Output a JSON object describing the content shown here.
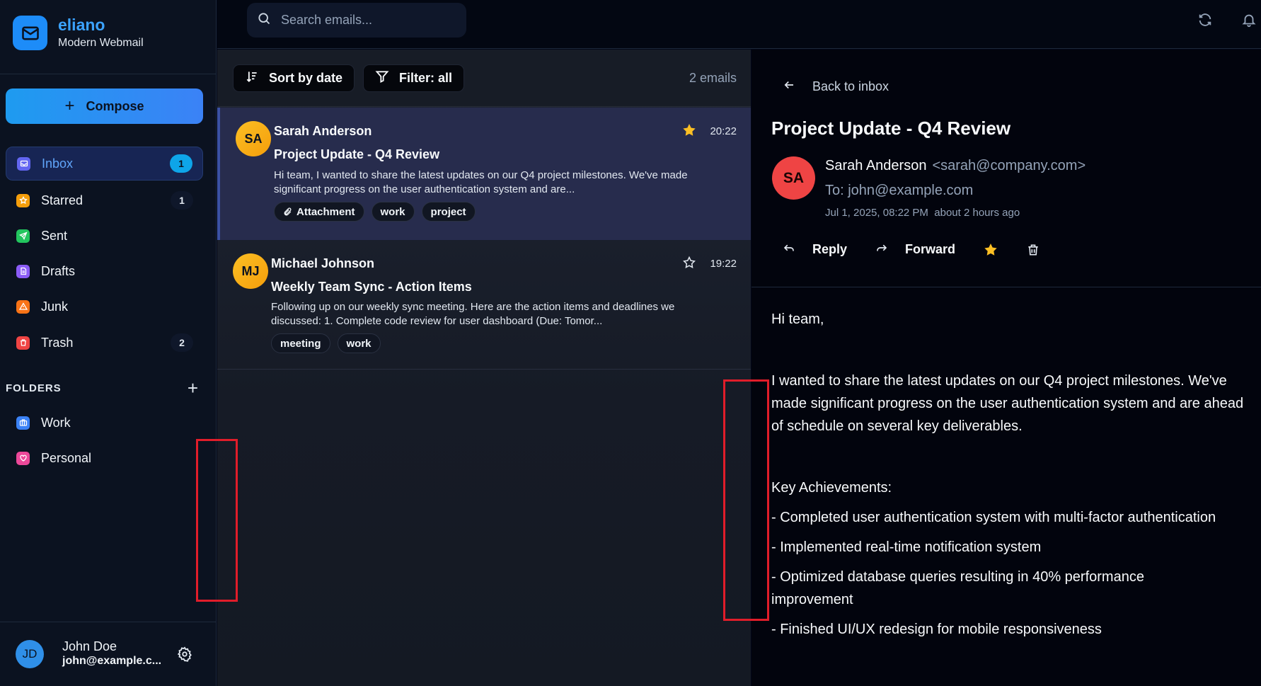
{
  "brand": {
    "name": "eliano",
    "subtitle": "Modern Webmail",
    "icon": "mail-icon"
  },
  "compose": {
    "label": "Compose",
    "icon": "plus-icon"
  },
  "nav": [
    {
      "label": "Inbox",
      "count": "1",
      "icon": "inbox-icon",
      "color": "#6366f1",
      "active": true
    },
    {
      "label": "Starred",
      "count": "1",
      "icon": "star-icon",
      "color": "#f59e0b"
    },
    {
      "label": "Sent",
      "count": "",
      "icon": "send-icon",
      "color": "#22c55e"
    },
    {
      "label": "Drafts",
      "count": "",
      "icon": "draft-icon",
      "color": "#8b5cf6"
    },
    {
      "label": "Junk",
      "count": "",
      "icon": "warning-icon",
      "color": "#f97316"
    },
    {
      "label": "Trash",
      "count": "2",
      "icon": "trash-icon",
      "color": "#ef4444"
    }
  ],
  "folders": {
    "title": "FOLDERS",
    "items": [
      {
        "label": "Work",
        "icon": "briefcase-icon",
        "color": "#3b82f6"
      },
      {
        "label": "Personal",
        "icon": "heart-icon",
        "color": "#ec4899"
      }
    ]
  },
  "user": {
    "initials": "JD",
    "name": "John Doe",
    "email": "john@example.c..."
  },
  "search": {
    "placeholder": "Search emails..."
  },
  "toolbar": {
    "sort_label": "Sort by date",
    "filter_label": "Filter: all",
    "count": "2 emails"
  },
  "emails": [
    {
      "initials": "SA",
      "from": "Sarah Anderson",
      "subject": "Project Update - Q4 Review",
      "preview": "Hi team, I wanted to share the latest updates on our Q4 project milestones. We've made significant progress on the user authentication system and are...",
      "time": "20:22",
      "starred": true,
      "tags": [
        "Attachment",
        "work",
        "project"
      ]
    },
    {
      "initials": "MJ",
      "from": "Michael Johnson",
      "subject": "Weekly Team Sync - Action Items",
      "preview": "Following up on our weekly sync meeting. Here are the action items and deadlines we discussed: 1. Complete code review for user dashboard (Due: Tomor...",
      "time": "19:22",
      "starred": false,
      "tags": [
        "meeting",
        "work"
      ]
    }
  ],
  "reader": {
    "back_label": "Back to inbox",
    "title": "Project Update - Q4 Review",
    "avatar": "SA",
    "from_name": "Sarah Anderson",
    "from_addr": "<sarah@company.com>",
    "to": "To: john@example.com",
    "date": "Jul 1, 2025, 08:22 PM",
    "relative": "about 2 hours ago",
    "reply_label": "Reply",
    "forward_label": "Forward",
    "body": {
      "greeting": "Hi team,",
      "para1": "I wanted to share the latest updates on our Q4 project milestones. We've made significant progress on the user authentication system and are ahead of schedule on several key deliverables.",
      "achievements_title": "Key Achievements:",
      "items": [
        "- Completed user authentication system with multi-factor authentication",
        "- Implemented real-time notification system",
        "- Optimized database queries resulting in 40% performance improvement",
        "- Finished UI/UX redesign for mobile responsiveness"
      ]
    }
  },
  "colors": {
    "accent": "#3ba3ff",
    "selected_row": "#272c4d",
    "star": "#fbbf24",
    "annotation": "#e11d2a"
  }
}
